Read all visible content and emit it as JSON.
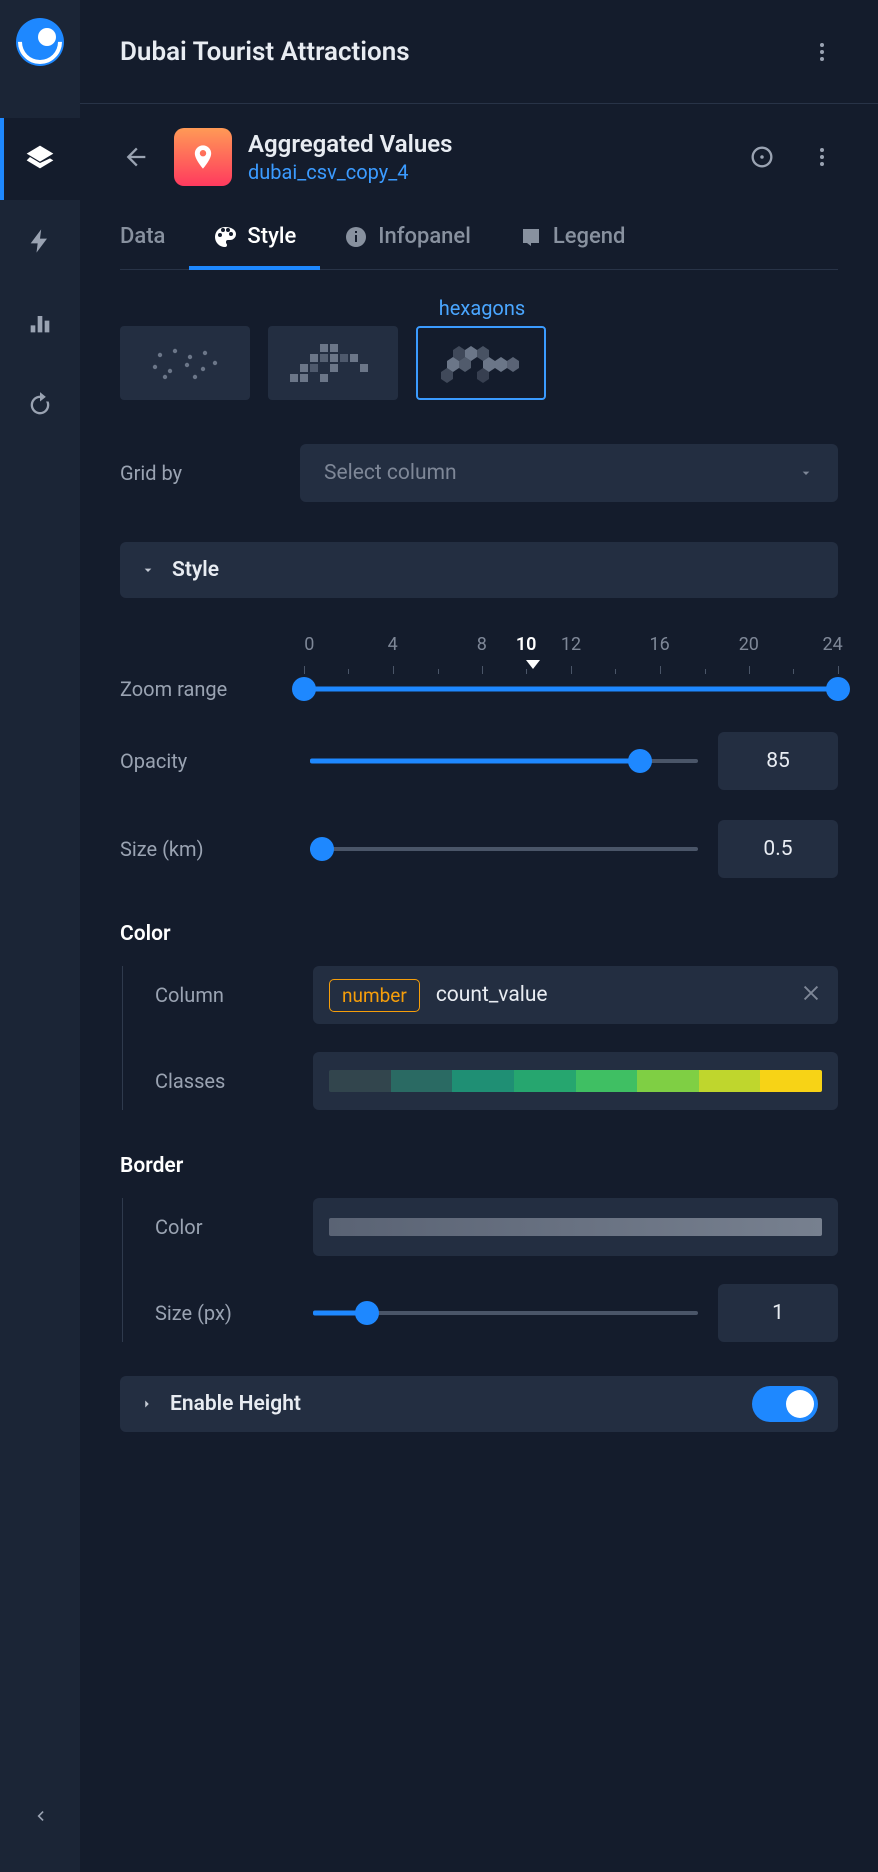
{
  "header": {
    "title": "Dubai Tourist Attractions"
  },
  "layer": {
    "title": "Aggregated Values",
    "subtitle": "dubai_csv_copy_4"
  },
  "tabs": {
    "data": "Data",
    "style": "Style",
    "infopanel": "Infopanel",
    "legend": "Legend"
  },
  "viz": {
    "selected_label": "hexagons"
  },
  "grid_by": {
    "label": "Grid by",
    "placeholder": "Select column"
  },
  "style_section": {
    "label": "Style"
  },
  "zoom": {
    "label": "Zoom range",
    "ticks": [
      "0",
      "4",
      "8",
      "10",
      "12",
      "16",
      "20",
      "24"
    ],
    "current": "10",
    "min": 0,
    "max": 24
  },
  "opacity": {
    "label": "Opacity",
    "value": "85",
    "percent": 85
  },
  "size_km": {
    "label": "Size (km)",
    "value": "0.5",
    "percent": 3
  },
  "color": {
    "title": "Color",
    "column_label": "Column",
    "type_chip": "number",
    "column_name": "count_value",
    "classes_label": "Classes",
    "ramp": [
      "#32454d",
      "#2a6a63",
      "#1f8f74",
      "#26a66f",
      "#3fbf63",
      "#7fcf44",
      "#bfd62d",
      "#f7d316"
    ]
  },
  "border": {
    "title": "Border",
    "color_label": "Color",
    "size_label": "Size (px)",
    "size_value": "1",
    "size_percent": 14
  },
  "height": {
    "label": "Enable Height",
    "enabled": true
  }
}
